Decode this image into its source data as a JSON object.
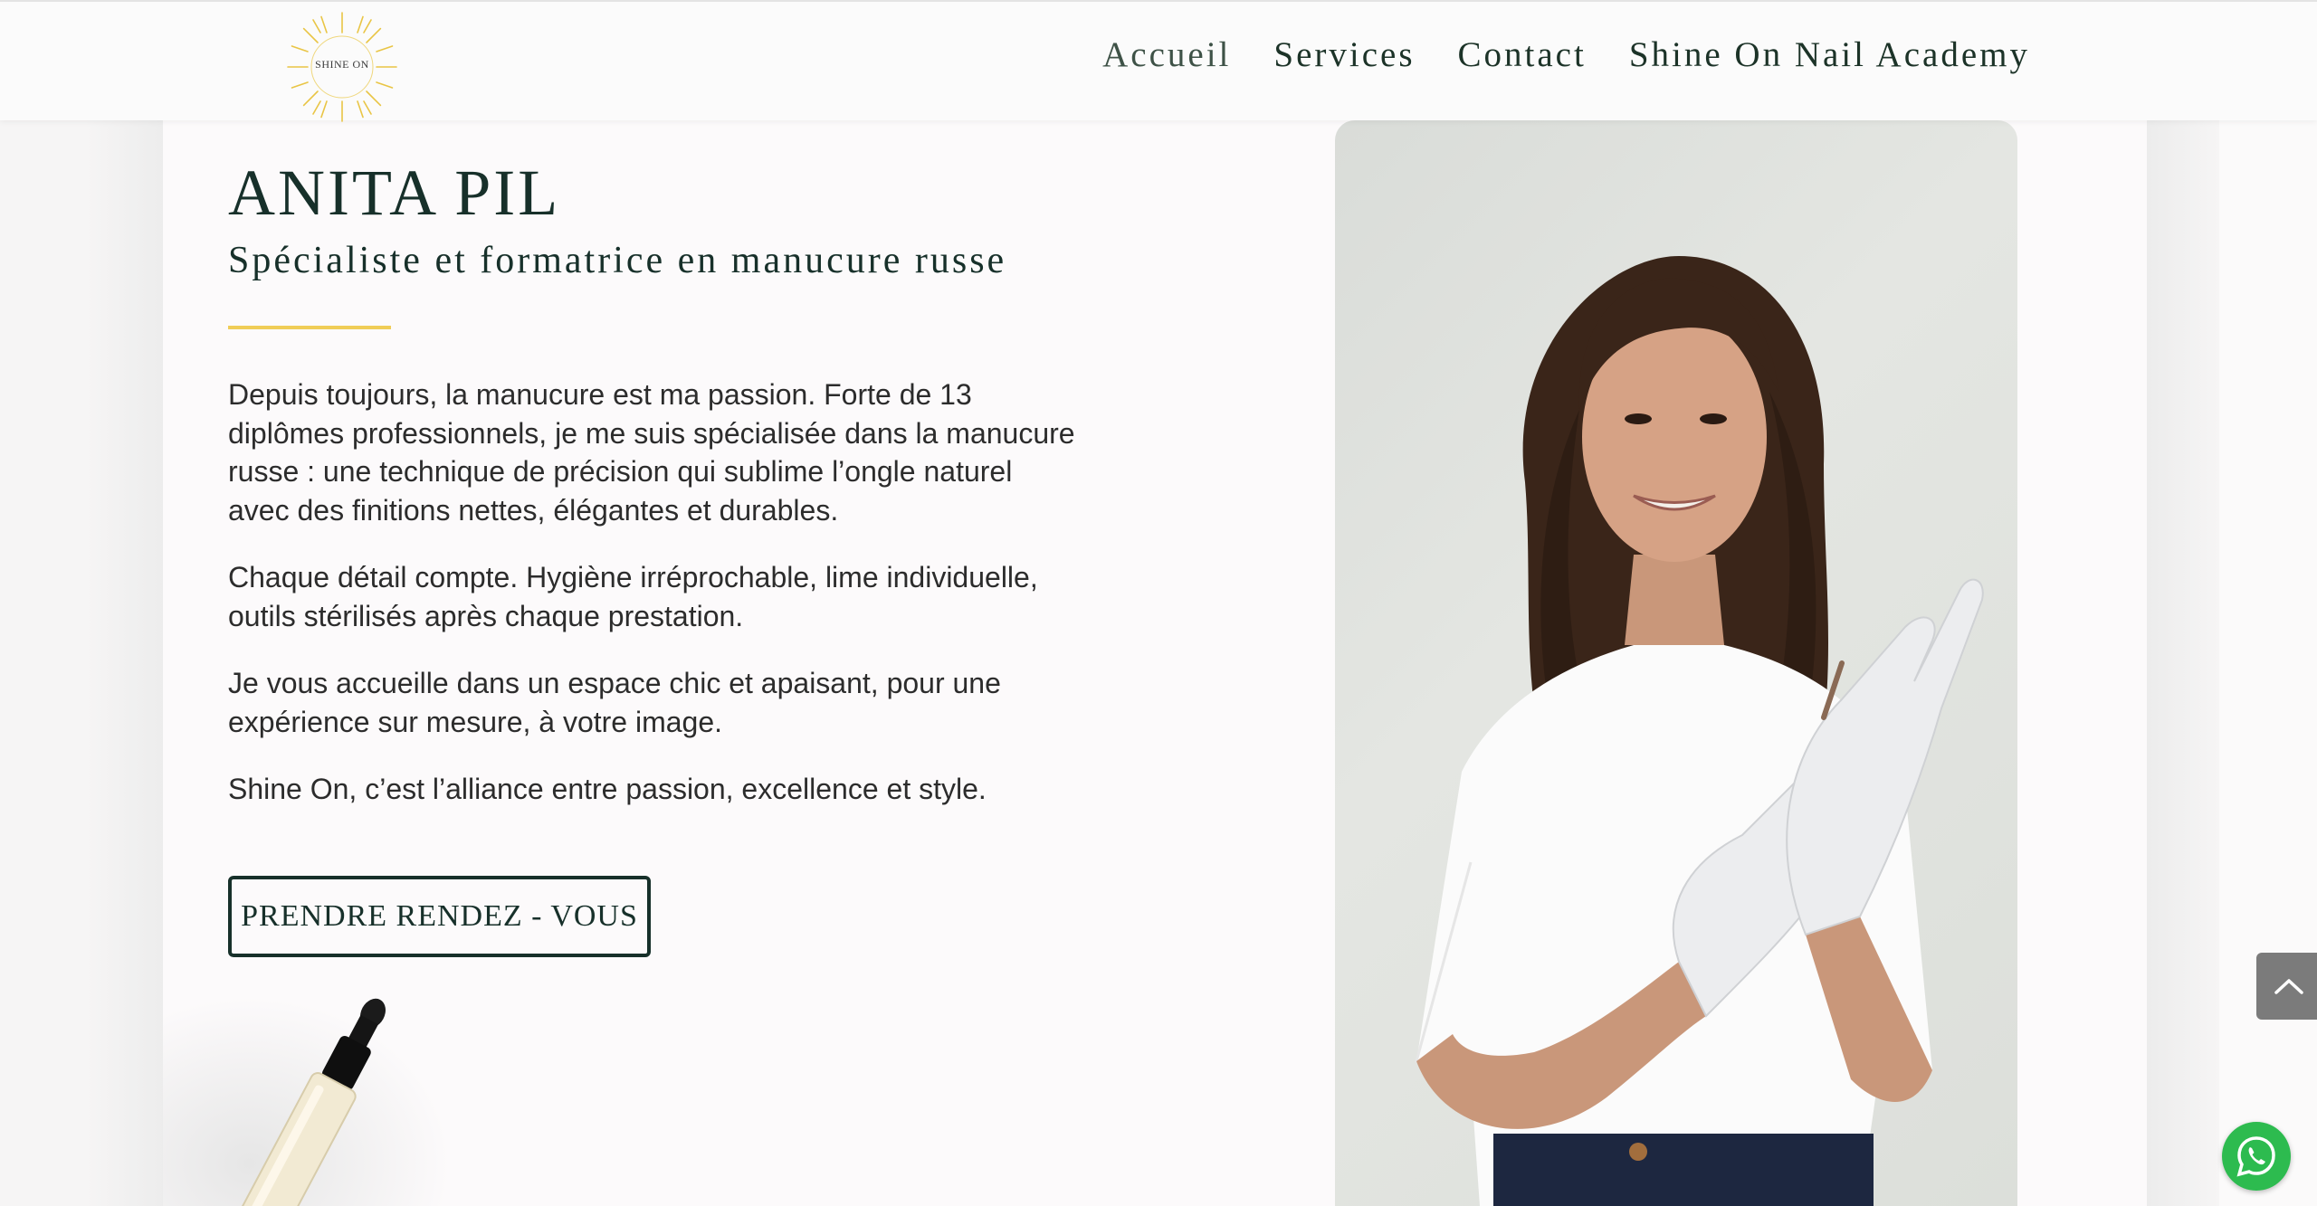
{
  "header": {
    "logo_text": "SHINE ON",
    "nav": [
      {
        "label": "Accueil"
      },
      {
        "label": "Services"
      },
      {
        "label": "Contact"
      },
      {
        "label": "Shine On Nail Academy"
      }
    ]
  },
  "hero": {
    "name": "ANITA PIL",
    "subtitle": "Spécialiste et formatrice en manucure russe",
    "paragraphs": [
      "Depuis toujours, la manucure est ma passion. Forte de 13 diplômes professionnels, je me suis spécialisée dans la manucure russe : une technique de précision qui sublime l’ongle naturel avec des finitions nettes, élégantes et durables.",
      "Chaque détail compte. Hygiène irréprochable, lime individuelle, outils stérilisés après chaque prestation.",
      "Je vous accueille dans un espace chic et apaisant, pour une expérience sur mesure, à votre image.",
      "Shine On, c’est l’alliance entre passion, excellence et style."
    ],
    "cta_label": "PRENDRE RENDEZ - VOUS"
  },
  "icons": {
    "scroll_top": "chevron-up-icon",
    "whatsapp": "whatsapp-icon",
    "logo": "sun-logo-icon"
  },
  "colors": {
    "accent_gold": "#f0cd57",
    "text_dark_green": "#17302a",
    "whatsapp_green": "#2dbb4f",
    "scroll_button_gray": "#7b7b7b"
  }
}
